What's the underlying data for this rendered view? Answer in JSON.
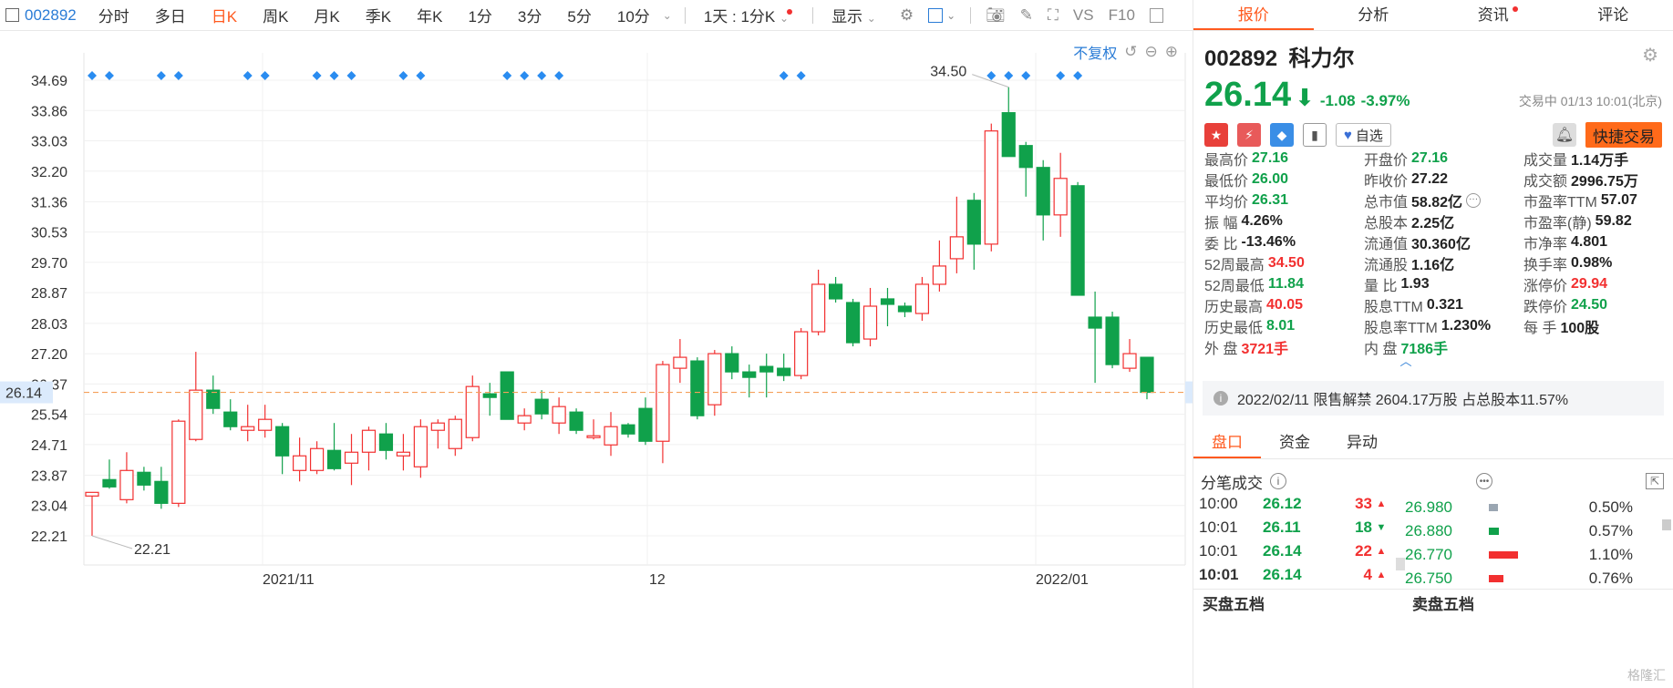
{
  "toolbar": {
    "code": "002892",
    "items": [
      "分时",
      "多日",
      "日K",
      "周K",
      "月K",
      "季K",
      "年K",
      "1分",
      "3分",
      "5分",
      "10分"
    ],
    "active": "日K",
    "period_select": "1天 : 1分K",
    "display_label": "显示",
    "vs_label": "VS",
    "f10_label": "F10"
  },
  "chart_controls": {
    "adjust_label": "不复权"
  },
  "chart_data": {
    "type": "candlestick",
    "y_ticks": [
      "34.69",
      "33.86",
      "33.03",
      "32.20",
      "31.36",
      "30.53",
      "29.70",
      "28.87",
      "28.03",
      "27.20",
      "26.37",
      "25.54",
      "24.71",
      "23.87",
      "23.04",
      "22.21"
    ],
    "ylim": [
      21.5,
      35.3
    ],
    "x_labels": [
      "2021/11",
      "12",
      "2022/01"
    ],
    "current_price": "26.14",
    "max_annotation": "34.50",
    "min_annotation": "22.21",
    "candles": [
      {
        "o": 23.3,
        "h": 23.4,
        "l": 22.21,
        "c": 23.4
      },
      {
        "o": 23.75,
        "h": 24.3,
        "l": 23.5,
        "c": 23.55
      },
      {
        "o": 23.2,
        "h": 24.5,
        "l": 23.1,
        "c": 24.0
      },
      {
        "o": 23.95,
        "h": 24.1,
        "l": 23.45,
        "c": 23.6
      },
      {
        "o": 23.7,
        "h": 24.1,
        "l": 22.95,
        "c": 23.1
      },
      {
        "o": 23.1,
        "h": 25.4,
        "l": 23.0,
        "c": 25.35
      },
      {
        "o": 24.85,
        "h": 27.25,
        "l": 24.8,
        "c": 26.2
      },
      {
        "o": 26.2,
        "h": 26.6,
        "l": 25.55,
        "c": 25.7
      },
      {
        "o": 25.6,
        "h": 25.95,
        "l": 25.1,
        "c": 25.2
      },
      {
        "o": 25.1,
        "h": 25.8,
        "l": 24.8,
        "c": 25.2
      },
      {
        "o": 25.1,
        "h": 25.8,
        "l": 24.9,
        "c": 25.4
      },
      {
        "o": 25.2,
        "h": 25.3,
        "l": 23.9,
        "c": 24.4
      },
      {
        "o": 24.0,
        "h": 24.9,
        "l": 23.7,
        "c": 24.4
      },
      {
        "o": 24.0,
        "h": 24.8,
        "l": 23.9,
        "c": 24.6
      },
      {
        "o": 24.55,
        "h": 25.3,
        "l": 24.0,
        "c": 24.05
      },
      {
        "o": 24.2,
        "h": 25.0,
        "l": 23.6,
        "c": 24.5
      },
      {
        "o": 24.5,
        "h": 25.2,
        "l": 24.0,
        "c": 25.1
      },
      {
        "o": 25.0,
        "h": 25.3,
        "l": 24.3,
        "c": 24.55
      },
      {
        "o": 24.4,
        "h": 25.0,
        "l": 24.0,
        "c": 24.5
      },
      {
        "o": 24.1,
        "h": 25.4,
        "l": 23.8,
        "c": 25.2
      },
      {
        "o": 25.1,
        "h": 25.4,
        "l": 24.6,
        "c": 25.3
      },
      {
        "o": 24.6,
        "h": 25.5,
        "l": 24.4,
        "c": 25.4
      },
      {
        "o": 24.9,
        "h": 26.6,
        "l": 24.8,
        "c": 26.3
      },
      {
        "o": 26.1,
        "h": 26.4,
        "l": 25.5,
        "c": 26.0
      },
      {
        "o": 26.7,
        "h": 26.7,
        "l": 25.4,
        "c": 25.4
      },
      {
        "o": 25.3,
        "h": 25.7,
        "l": 25.1,
        "c": 25.5
      },
      {
        "o": 25.95,
        "h": 26.2,
        "l": 25.4,
        "c": 25.55
      },
      {
        "o": 25.3,
        "h": 26.0,
        "l": 25.0,
        "c": 25.75
      },
      {
        "o": 25.6,
        "h": 25.7,
        "l": 25.0,
        "c": 25.1
      },
      {
        "o": 24.9,
        "h": 25.4,
        "l": 24.85,
        "c": 24.95
      },
      {
        "o": 24.7,
        "h": 25.6,
        "l": 24.4,
        "c": 25.2
      },
      {
        "o": 25.25,
        "h": 25.3,
        "l": 24.9,
        "c": 25.0
      },
      {
        "o": 25.7,
        "h": 26.0,
        "l": 24.7,
        "c": 24.8
      },
      {
        "o": 24.8,
        "h": 27.0,
        "l": 24.2,
        "c": 26.9
      },
      {
        "o": 26.8,
        "h": 27.6,
        "l": 26.4,
        "c": 27.1
      },
      {
        "o": 27.0,
        "h": 27.1,
        "l": 25.4,
        "c": 25.5
      },
      {
        "o": 25.8,
        "h": 27.3,
        "l": 25.5,
        "c": 27.2
      },
      {
        "o": 27.2,
        "h": 27.4,
        "l": 26.5,
        "c": 26.7
      },
      {
        "o": 26.7,
        "h": 26.9,
        "l": 26.0,
        "c": 26.55
      },
      {
        "o": 26.85,
        "h": 27.2,
        "l": 26.0,
        "c": 26.7
      },
      {
        "o": 26.8,
        "h": 27.2,
        "l": 26.45,
        "c": 26.6
      },
      {
        "o": 26.6,
        "h": 27.9,
        "l": 26.5,
        "c": 27.8
      },
      {
        "o": 27.8,
        "h": 29.5,
        "l": 27.7,
        "c": 29.1
      },
      {
        "o": 29.1,
        "h": 29.3,
        "l": 28.6,
        "c": 28.7
      },
      {
        "o": 28.6,
        "h": 28.7,
        "l": 27.4,
        "c": 27.5
      },
      {
        "o": 27.6,
        "h": 29.0,
        "l": 27.4,
        "c": 28.5
      },
      {
        "o": 28.7,
        "h": 29.0,
        "l": 27.95,
        "c": 28.55
      },
      {
        "o": 28.5,
        "h": 28.6,
        "l": 28.2,
        "c": 28.35
      },
      {
        "o": 28.3,
        "h": 29.3,
        "l": 28.1,
        "c": 29.1
      },
      {
        "o": 29.1,
        "h": 30.3,
        "l": 28.9,
        "c": 29.6
      },
      {
        "o": 29.8,
        "h": 31.5,
        "l": 29.4,
        "c": 30.4
      },
      {
        "o": 31.4,
        "h": 31.6,
        "l": 29.5,
        "c": 30.2
      },
      {
        "o": 30.2,
        "h": 33.5,
        "l": 30.0,
        "c": 33.3
      },
      {
        "o": 33.8,
        "h": 34.5,
        "l": 32.6,
        "c": 32.6
      },
      {
        "o": 32.9,
        "h": 33.0,
        "l": 31.5,
        "c": 32.3
      },
      {
        "o": 32.3,
        "h": 32.5,
        "l": 30.3,
        "c": 31.0
      },
      {
        "o": 31.0,
        "h": 32.7,
        "l": 30.4,
        "c": 32.0
      },
      {
        "o": 31.8,
        "h": 31.9,
        "l": 28.8,
        "c": 28.8
      },
      {
        "o": 28.2,
        "h": 28.9,
        "l": 26.4,
        "c": 27.9
      },
      {
        "o": 28.2,
        "h": 28.35,
        "l": 26.8,
        "c": 26.9
      },
      {
        "o": 26.8,
        "h": 27.6,
        "l": 26.7,
        "c": 27.2
      },
      {
        "o": 27.1,
        "h": 27.1,
        "l": 25.95,
        "c": 26.14
      }
    ],
    "markers": [
      0,
      1,
      4,
      5,
      9,
      10,
      13,
      14,
      15,
      18,
      19,
      24,
      25,
      26,
      27,
      40,
      41,
      52,
      53,
      54,
      56,
      57
    ]
  },
  "stock": {
    "code": "002892",
    "name": "科力尔",
    "price": "26.14",
    "change": "-1.08",
    "pct": "-3.97%",
    "time": "交易中 01/13 10:01(北京)",
    "fav_label": "自选",
    "quick_trade": "快捷交易"
  },
  "metrics": [
    {
      "label": "最高价",
      "value": "27.16",
      "color": "green"
    },
    {
      "label": "开盘价",
      "value": "27.16",
      "color": "green"
    },
    {
      "label": "成交量",
      "value": "1.14万手",
      "color": ""
    },
    {
      "label": "最低价",
      "value": "26.00",
      "color": "green"
    },
    {
      "label": "昨收价",
      "value": "27.22",
      "color": ""
    },
    {
      "label": "成交额",
      "value": "2996.75万",
      "color": ""
    },
    {
      "label": "平均价",
      "value": "26.31",
      "color": "green"
    },
    {
      "label": "总市值",
      "value": "58.82亿",
      "color": ""
    },
    {
      "label": "市盈率TTM",
      "value": "57.07",
      "color": ""
    },
    {
      "label": "振 幅",
      "value": "4.26%",
      "color": ""
    },
    {
      "label": "总股本",
      "value": "2.25亿",
      "color": ""
    },
    {
      "label": "市盈率(静)",
      "value": "59.82",
      "color": ""
    },
    {
      "label": "委 比",
      "value": "-13.46%",
      "color": ""
    },
    {
      "label": "流通值",
      "value": "30.360亿",
      "color": ""
    },
    {
      "label": "市净率",
      "value": "4.801",
      "color": ""
    },
    {
      "label": "52周最高",
      "value": "34.50",
      "color": "red"
    },
    {
      "label": "流通股",
      "value": "1.16亿",
      "color": ""
    },
    {
      "label": "换手率",
      "value": "0.98%",
      "color": ""
    },
    {
      "label": "52周最低",
      "value": "11.84",
      "color": "green"
    },
    {
      "label": "量 比",
      "value": "1.93",
      "color": ""
    },
    {
      "label": "涨停价",
      "value": "29.94",
      "color": "red"
    },
    {
      "label": "历史最高",
      "value": "40.05",
      "color": "red"
    },
    {
      "label": "股息TTM",
      "value": "0.321",
      "color": ""
    },
    {
      "label": "跌停价",
      "value": "24.50",
      "color": "green"
    },
    {
      "label": "历史最低",
      "value": "8.01",
      "color": "green"
    },
    {
      "label": "股息率TTM",
      "value": "1.230%",
      "color": ""
    },
    {
      "label": "每 手",
      "value": "100股",
      "color": ""
    },
    {
      "label": "外 盘",
      "value": "3721手",
      "color": "red"
    },
    {
      "label": "内 盘",
      "value": "7186手",
      "color": "green"
    }
  ],
  "notice": {
    "text": "2022/02/11  限售解禁 2604.17万股 占总股本11.57%"
  },
  "tabs": [
    "报价",
    "分析",
    "资讯",
    "评论"
  ],
  "subtabs": [
    "盘口",
    "资金",
    "异动"
  ],
  "ticks_title": "分笔成交",
  "ticks": [
    {
      "time": "10:00",
      "price": "26.12",
      "vol": "33",
      "dir": "up"
    },
    {
      "time": "10:01",
      "price": "26.11",
      "vol": "18",
      "dir": "down"
    },
    {
      "time": "10:01",
      "price": "26.14",
      "vol": "22",
      "dir": "up"
    },
    {
      "time": "10:01",
      "price": "26.14",
      "vol": "4",
      "dir": "up"
    }
  ],
  "distribution": [
    {
      "price": "26.980",
      "pct": "0.50%",
      "frac": 0.06,
      "color": "#9aa6b2"
    },
    {
      "price": "26.880",
      "pct": "0.57%",
      "frac": 0.07,
      "color": "#10a14b"
    },
    {
      "price": "26.770",
      "pct": "1.10%",
      "frac": 0.2,
      "color": "#f23030"
    },
    {
      "price": "26.750",
      "pct": "0.76%",
      "frac": 0.1,
      "color": "#f23030"
    }
  ],
  "book": {
    "buy_title": "买盘五档",
    "sell_title": "卖盘五档"
  },
  "watermark": "格隆汇",
  "colors": {
    "up": "#f23030",
    "down": "#10a14b",
    "accent": "#ff5a1f",
    "link": "#2a7cd6"
  }
}
